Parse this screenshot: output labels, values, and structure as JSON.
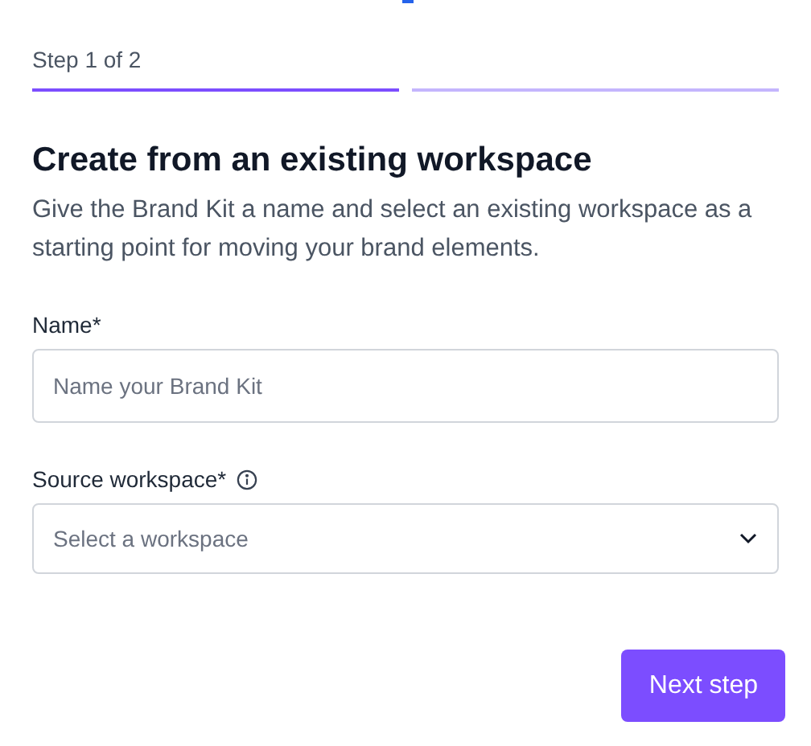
{
  "progress": {
    "label": "Step 1 of 2",
    "segments": [
      {
        "completed": true
      },
      {
        "completed": false
      }
    ]
  },
  "title": "Create from an existing workspace",
  "description": "Give the Brand Kit a name and select an existing workspace as a starting point for moving your brand elements.",
  "fields": [
    {
      "kind": "text",
      "label": "Name*",
      "placeholder": "Name your Brand Kit",
      "info": false
    },
    {
      "kind": "select",
      "label": "Source workspace*",
      "placeholder": "Select a workspace",
      "info": true
    }
  ],
  "buttons": [
    {
      "label": "Next step"
    }
  ]
}
